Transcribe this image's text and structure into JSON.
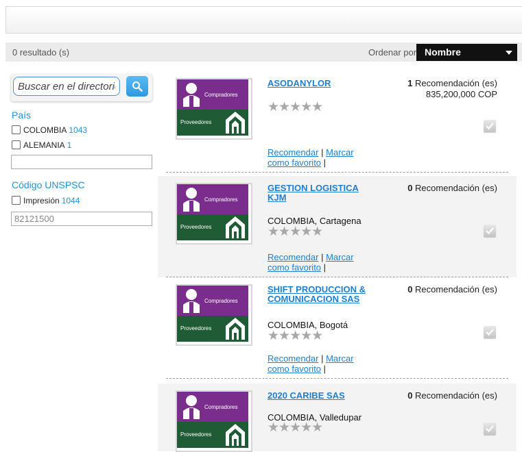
{
  "results": {
    "count_label": "0 resultado (s)"
  },
  "sort": {
    "label": "Ordenar por:",
    "selected": "Nombre"
  },
  "search": {
    "placeholder": "Buscar en el directorio"
  },
  "facets": {
    "country": {
      "title": "País",
      "options": [
        {
          "label": "COLOMBIA",
          "count": "1043"
        },
        {
          "label": "ALEMANIA",
          "count": "1"
        }
      ],
      "input_value": ""
    },
    "unspsc": {
      "title": "Código UNSPSC",
      "options": [
        {
          "label": "Impresión",
          "count": "1044"
        }
      ],
      "input_value": "82121500"
    }
  },
  "logo": {
    "top_label": "Compradores",
    "bottom_label": "Proveedores"
  },
  "link_labels": {
    "recommend": "Recomendar",
    "separator": "|",
    "favorite": "Marcar como favorito",
    "trail": "|"
  },
  "cards": [
    {
      "name": "ASODANYLOR",
      "location": "",
      "rec_count": "1",
      "rec_label": "Recomendación (es)",
      "amount": "835,200,000 COP",
      "stars": "★★★★★"
    },
    {
      "name": "GESTION LOGISTICA KJM",
      "location": "COLOMBIA, Cartagena",
      "rec_count": "0",
      "rec_label": "Recomendación (es)",
      "amount": "",
      "stars": "★★★★★"
    },
    {
      "name": "SHIFT PRODUCCION & COMUNICACION SAS",
      "location": "COLOMBIA, Bogotá",
      "rec_count": "0",
      "rec_label": "Recomendación (es)",
      "amount": "",
      "stars": "★★★★★"
    },
    {
      "name": "2020 CARIBE SAS",
      "location": "COLOMBIA, Valledupar",
      "rec_count": "0",
      "rec_label": "Recomendación (es)",
      "amount": "",
      "stars": "★★★★★"
    }
  ],
  "colors": {
    "accent": "#1e93d6",
    "link": "#1e7fd0",
    "logo_purple": "#7b2d8e",
    "logo_green": "#1f5b34"
  }
}
